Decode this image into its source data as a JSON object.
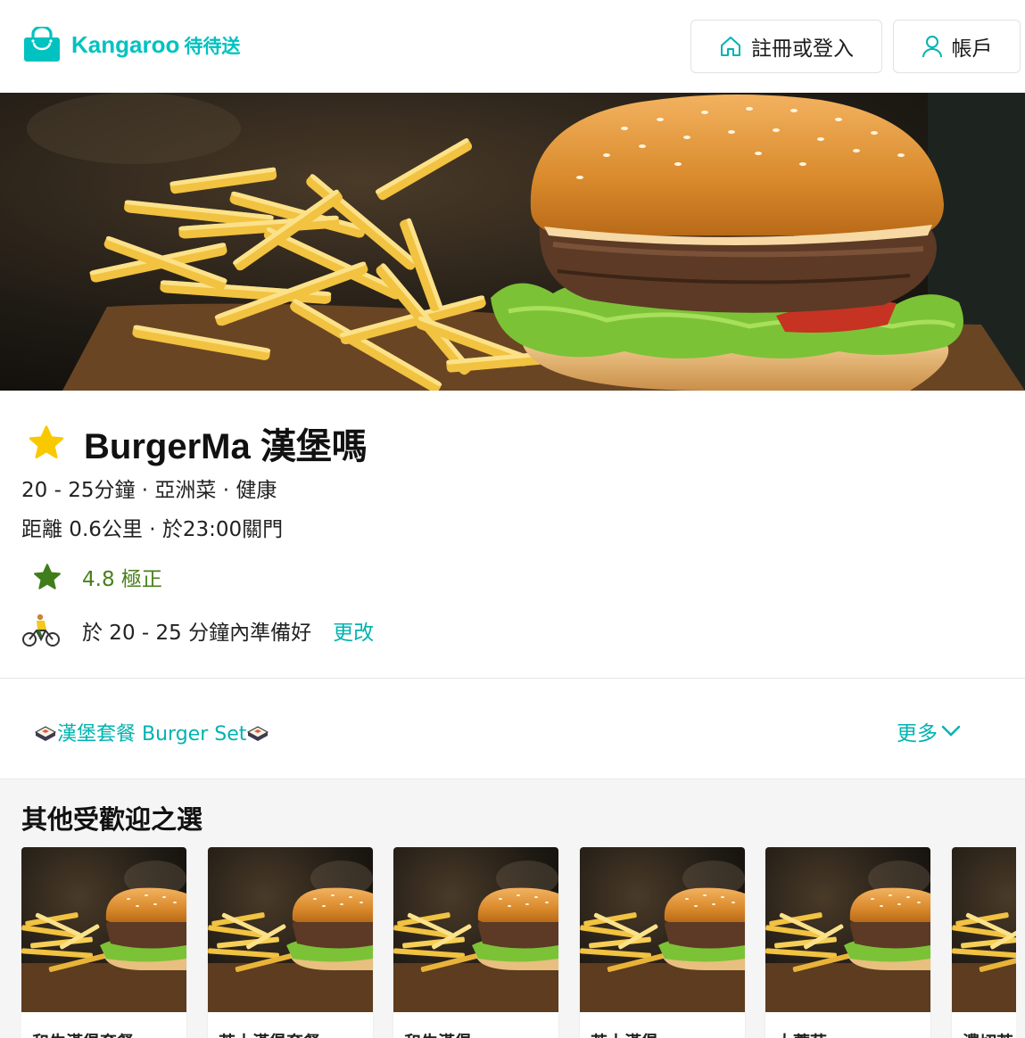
{
  "brand": {
    "name": "Kangaroo",
    "name_zh": "待待送",
    "color": "#00c2c0"
  },
  "header": {
    "login_label": "註冊或登入",
    "account_label": "帳戶"
  },
  "restaurant": {
    "name": "BurgerMa 漢堡嗎",
    "meta_line1": "20 - 25分鐘 · 亞洲菜 · 健康",
    "meta_line2": "距離 0.6公里 · 於23:00關門",
    "rating_text": "4.8 極正",
    "ready_text": "於 20 - 25 分鐘內準備好",
    "change_label": "更改"
  },
  "category_bar": {
    "active_tab": "漢堡套餐 Burger Set",
    "more_label": "更多"
  },
  "popular": {
    "title": "其他受歡迎之選",
    "items": [
      {
        "name": "和牛漢堡套餐"
      },
      {
        "name": "芝士漢堡套餐"
      },
      {
        "name": "和牛漢堡"
      },
      {
        "name": "芝士漢堡"
      },
      {
        "name": "大蘑菇"
      },
      {
        "name": "濃切芝"
      }
    ]
  },
  "icons": {
    "logo": "shopping-bag-icon",
    "login": "home-icon",
    "account": "user-icon",
    "favorite": "star-icon",
    "rating": "star-icon",
    "delivery": "cyclist-icon",
    "category": "sushi-icon",
    "more": "chevron-down-icon"
  },
  "colors": {
    "accent": "#00c2c0",
    "rating": "#4a7f1c",
    "favorite": "#f9c900"
  }
}
